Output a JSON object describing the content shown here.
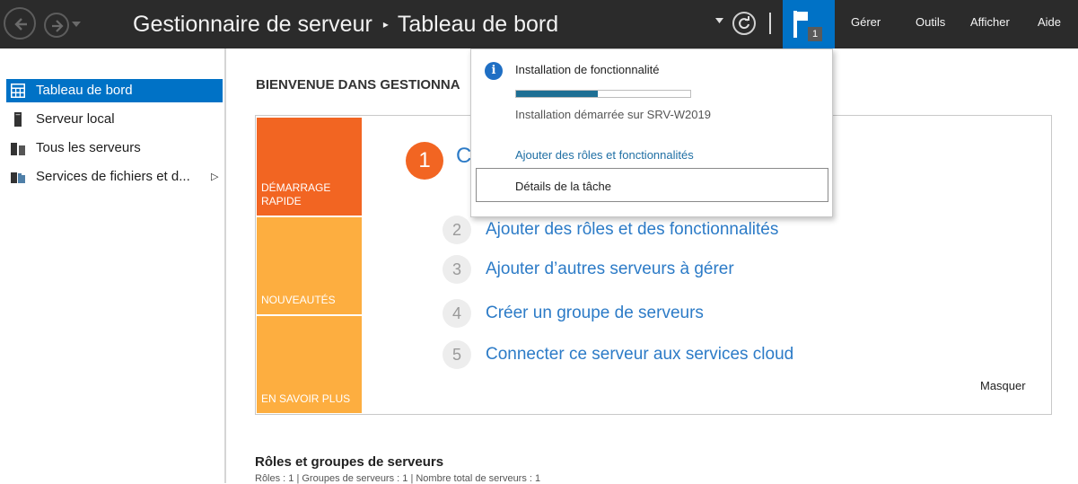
{
  "titlebar": {
    "app_name": "Gestionnaire de serveur",
    "separator": "▸",
    "page": "Tableau de bord",
    "notification_count": "1",
    "menus": [
      "Gérer",
      "Outils",
      "Afficher",
      "Aide"
    ]
  },
  "sidebar": {
    "items": [
      {
        "label": "Tableau de bord",
        "icon": "dashboard-icon"
      },
      {
        "label": "Serveur local",
        "icon": "local-server-icon"
      },
      {
        "label": "Tous les serveurs",
        "icon": "all-servers-icon"
      },
      {
        "label": "Services de fichiers et d...",
        "icon": "file-services-icon",
        "arrow": "▷"
      }
    ]
  },
  "welcome": {
    "title": "BIENVENUE DANS GESTIONNA",
    "tiles": [
      "DÉMARRAGE RAPIDE",
      "NOUVEAUTÉS",
      "EN SAVOIR PLUS"
    ],
    "step1": {
      "num": "1",
      "text": "C"
    },
    "steps": [
      {
        "num": "2",
        "text": "Ajouter des rôles et des fonctionnalités"
      },
      {
        "num": "3",
        "text": "Ajouter d’autres serveurs à gérer"
      },
      {
        "num": "4",
        "text": "Créer un groupe de serveurs"
      },
      {
        "num": "5",
        "text": "Connecter ce serveur aux services cloud"
      }
    ],
    "hide_label": "Masquer"
  },
  "roles": {
    "title": "Rôles et groupes de serveurs",
    "subtitle": "Rôles : 1   |   Groupes de serveurs : 1   |   Nombre total de serveurs : 1"
  },
  "notification": {
    "title": "Installation de fonctionnalité",
    "progress_percent": 47,
    "status": "Installation démarrée sur SRV-W2019",
    "link": "Ajouter des rôles et fonctionnalités",
    "details": "Détails de la tâche"
  },
  "colors": {
    "titlebar_bg": "#2b2b2b",
    "accent_blue": "#0072c6",
    "tile_orange_dark": "#f26522",
    "tile_orange_light": "#fdae40",
    "link_blue": "#2c7bc7",
    "progress_fill": "#1d6f94"
  }
}
